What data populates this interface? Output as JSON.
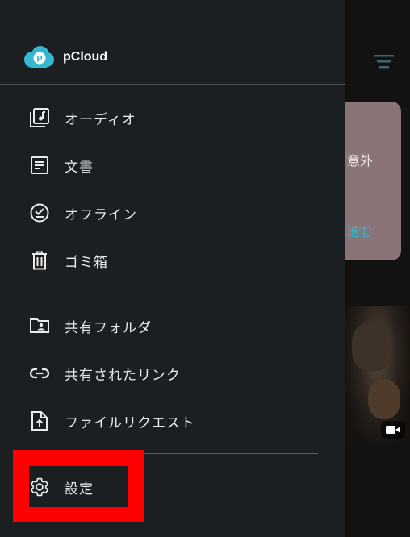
{
  "app": {
    "name": "pCloud"
  },
  "colors": {
    "drawer_bg": "#1b1f21",
    "accent": "#35b6d1",
    "highlight": "#ff0000",
    "text": "#e8eaeb"
  },
  "drawer": {
    "section1": [
      {
        "label": "オーディオ",
        "icon": "audio-icon"
      },
      {
        "label": "文書",
        "icon": "document-icon"
      },
      {
        "label": "オフライン",
        "icon": "offline-check-icon"
      },
      {
        "label": "ゴミ箱",
        "icon": "trash-icon"
      }
    ],
    "section2": [
      {
        "label": "共有フォルダ",
        "icon": "shared-folder-icon"
      },
      {
        "label": "共有されたリンク",
        "icon": "link-icon"
      },
      {
        "label": "ファイルリクエスト",
        "icon": "file-request-icon"
      }
    ],
    "section3": [
      {
        "label": "設定",
        "icon": "gear-icon"
      }
    ]
  },
  "background": {
    "card_text": "も意外",
    "card_link": "に進む"
  }
}
